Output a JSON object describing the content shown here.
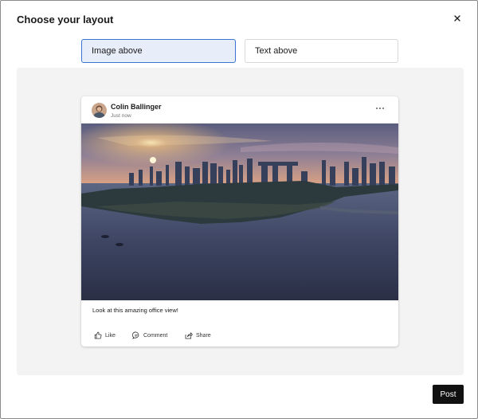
{
  "dialog": {
    "title": "Choose your layout",
    "close_icon": "close-icon"
  },
  "layout_options": [
    {
      "label": "Image above",
      "selected": true
    },
    {
      "label": "Text above",
      "selected": false
    }
  ],
  "post": {
    "author": "Colin Ballinger",
    "timestamp": "Just now",
    "more_icon": "more-icon",
    "image_alt": "city skyline at sunset over bay",
    "caption": "Look at this amazing office view!",
    "actions": [
      {
        "label": "Like",
        "icon": "like-icon"
      },
      {
        "label": "Comment",
        "icon": "comment-icon"
      },
      {
        "label": "Share",
        "icon": "share-icon"
      }
    ]
  },
  "footer": {
    "post_label": "Post"
  },
  "colors": {
    "accent": "#3a73d4",
    "selected_bg": "#e7eef9",
    "preview_bg": "#f3f3f3",
    "primary_button": "#111111"
  }
}
